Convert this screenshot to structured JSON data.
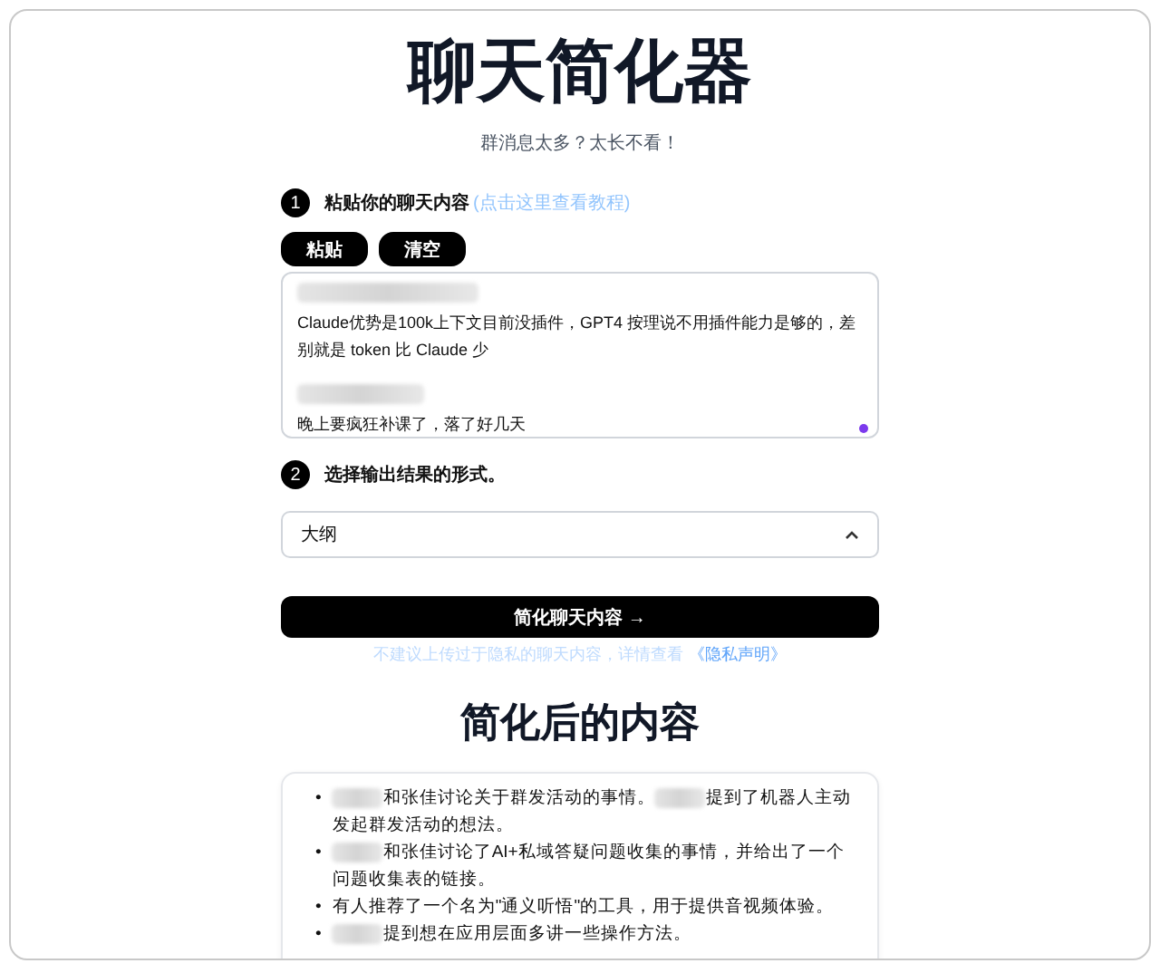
{
  "title": "聊天简化器",
  "subtitle": "群消息太多？太长不看！",
  "step1": {
    "number": "1",
    "label": "粘贴你的聊天内容",
    "link": "(点击这里查看教程)"
  },
  "buttons": [
    "粘贴",
    "清空"
  ],
  "chat_messages": [
    {
      "text": "Claude优势是100k上下文目前没插件，GPT4 按理说不用插件能力是够的，差别就是 token 比 Claude 少"
    },
    {
      "text": "晚上要疯狂补课了，落了好几天"
    }
  ],
  "step2": {
    "number": "2",
    "label": "选择输出结果的形式。"
  },
  "format_select": {
    "value": "大纲",
    "expanded": true
  },
  "submit_button": "简化聊天内容 →",
  "privacy_note": {
    "text": "不建议上传过于隐私的聊天内容，详情查看",
    "link": "《隐私声明》"
  },
  "result_heading": "简化后的内容",
  "bullet": "•",
  "summary": [
    [
      {
        "kind": "redacted"
      },
      {
        "kind": "text",
        "text": "和张佳讨论关于群发活动的事情。"
      },
      {
        "kind": "redacted"
      },
      {
        "kind": "text",
        "text": "提到了机器人主动发起群发活动的想法。"
      }
    ],
    [
      {
        "kind": "redacted"
      },
      {
        "kind": "text",
        "text": "和张佳讨论了AI+私域答疑问题收集的事情，并给出了一个问题收集表的链接。"
      }
    ],
    [
      {
        "kind": "text",
        "text": "有人推荐了一个名为\"通义听悟\"的工具，用于提供音视频体验。"
      }
    ],
    [
      {
        "kind": "redacted"
      },
      {
        "kind": "text",
        "text": "提到想在应用层面多讲一些操作方法。"
      }
    ]
  ]
}
